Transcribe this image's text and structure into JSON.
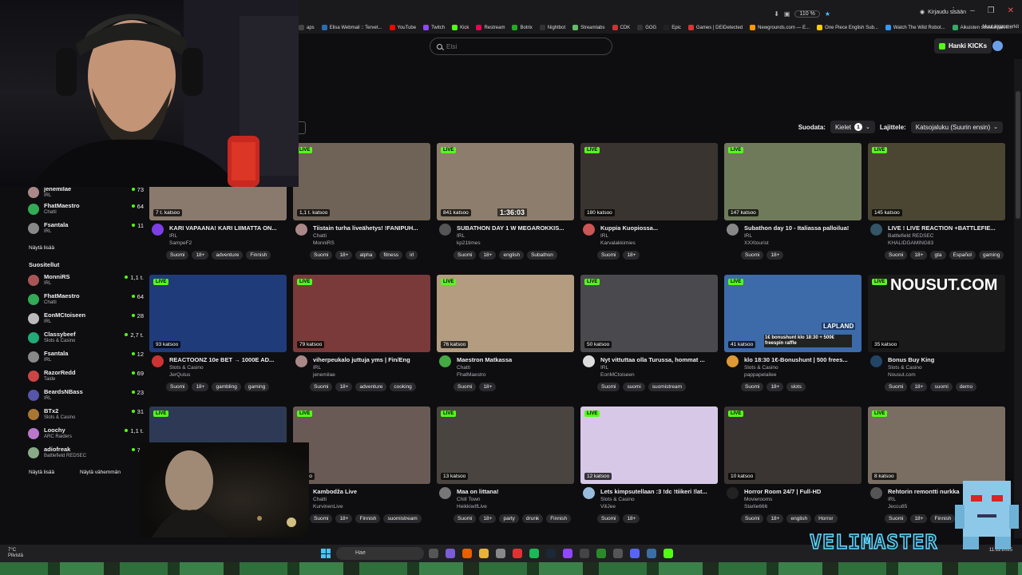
{
  "browser": {
    "zoom": "110 %",
    "signin": "Kirjaudu sisään",
    "bookmarks": [
      "aps",
      "Elisa Webmail :: Tervet...",
      "YouTube",
      "Twitch",
      "Kick",
      "Restream",
      "Botrix",
      "Nightbot",
      "Streamlabs",
      "CDK",
      "GOG",
      "Epic",
      "Games | DEIDetected",
      "Newgrounds.com — E...",
      "One Piece English Sub...",
      "Watch The Wild Robot...",
      "Aikuisten sosiaalipalve..."
    ],
    "bookmarks_more": "Muut kirjanmerkit"
  },
  "header": {
    "search_placeholder": "Etsi",
    "get_kicks": "Hanki KICKs"
  },
  "filters": {
    "sort_by_label": "Suodata:",
    "languages_label": "Kielet",
    "languages_count": "1",
    "sort_label": "Lajittele:",
    "sort_value": "Katsojaluku (Suurin ensin)"
  },
  "sidebar": {
    "followed_partial": {
      "name": "jenemilae",
      "category": "IRL",
      "count": "73"
    },
    "followed": [
      {
        "name": "FhatMaestro",
        "category": "Chatti",
        "count": "64"
      },
      {
        "name": "Fsantala",
        "category": "IRL",
        "count": "11"
      }
    ],
    "show_more": "Näytä lisää",
    "recommended_title": "Suositellut",
    "recommended": [
      {
        "name": "MonniRS",
        "category": "IRL",
        "count": "1,1 t."
      },
      {
        "name": "FhatMaestro",
        "category": "Chatti",
        "count": "64"
      },
      {
        "name": "EonMCtoiseen",
        "category": "IRL",
        "count": "28"
      },
      {
        "name": "Classybeef",
        "category": "Slots & Casino",
        "count": "2,7 t."
      },
      {
        "name": "Fsantala",
        "category": "IRL",
        "count": "12"
      },
      {
        "name": "RazorRedd",
        "category": "Taide",
        "count": "69"
      },
      {
        "name": "BeardsNBass",
        "category": "IRL",
        "count": "23"
      },
      {
        "name": "BTx2",
        "category": "Slots & Casino",
        "count": "31"
      },
      {
        "name": "Loochy",
        "category": "ARC Raiders",
        "count": "1,1 t."
      },
      {
        "name": "adiofreak",
        "category": "Battlefield REDSEC",
        "count": "76"
      }
    ],
    "show_more2": "Näytä lisää",
    "show_less": "Näytä vähemmän"
  },
  "streams": [
    {
      "live": "LIVE",
      "viewers": "7 t. katsoo",
      "title": "KARI VAPAANA! KARI LIIMATTA ON...",
      "category": "IRL",
      "user": "SampeF2",
      "tags": [
        "Suomi",
        "18+",
        "adventure",
        "Finnish"
      ],
      "thumb_color": "#8a7a6e",
      "avatar_color": "#7b3fe4"
    },
    {
      "live": "LIVE",
      "viewers": "1,1 t. katsoo",
      "title": "Tiistain turha liveähetys! !FANIPUH...",
      "category": "Chatti",
      "user": "MonniRS",
      "tags": [
        "Suomi",
        "18+",
        "alpha",
        "fitness",
        "irl"
      ],
      "thumb_color": "#6f6256",
      "avatar_color": "#a88"
    },
    {
      "live": "LIVE",
      "viewers": "841 katsoo",
      "title": "SUBATHON DAY 1 W MEGAROKKIS...",
      "category": "IRL",
      "user": "kp21times",
      "tags": [
        "Suomi",
        "18+",
        "english",
        "Subathon"
      ],
      "thumb_color": "#8c7d6c",
      "avatar_color": "#555"
    },
    {
      "live": "LIVE",
      "viewers": "180 katsoo",
      "title": "Kuppia Kuopiossa...",
      "category": "IRL",
      "user": "Karvalakkimies",
      "tags": [
        "Suomi",
        "18+"
      ],
      "thumb_color": "#3a3430",
      "avatar_color": "#c55"
    },
    {
      "live": "LIVE",
      "viewers": "147 katsoo",
      "title": "Subathon day 10 - Italiassa palloilua!",
      "category": "IRL",
      "user": "XXXtourist",
      "tags": [
        "Suomi",
        "18+"
      ],
      "thumb_color": "#6f7a5a",
      "avatar_color": "#888"
    },
    {
      "live": "LIVE",
      "viewers": "145 katsoo",
      "title": "LIVE ! LIVE REACTION +BATTLEFIE...",
      "category": "Battlefield REDSEC",
      "user": "KHALIDGAMING83",
      "tags": [
        "Suomi",
        "18+",
        "gta",
        "Español",
        "gaming"
      ],
      "thumb_color": "#4a4632",
      "avatar_color": "#356"
    },
    {
      "live": "LIVE",
      "viewers": "93 katsoo",
      "title": "REACTOONZ 10e BET → 1000E AD...",
      "category": "Slots & Casino",
      "user": "JerQutus",
      "tags": [
        "Suomi",
        "18+",
        "gambling",
        "gaming"
      ],
      "thumb_color": "#1f3b7a",
      "avatar_color": "#c33"
    },
    {
      "live": "LIVE",
      "viewers": "79 katsoo",
      "title": "viherpeukalo juttuja yms | Fin/Eng",
      "category": "IRL",
      "user": "jenemilae",
      "tags": [
        "Suomi",
        "18+",
        "adventure",
        "cooking"
      ],
      "thumb_color": "#7a3a3a",
      "avatar_color": "#a88"
    },
    {
      "live": "LIVE",
      "viewers": "76 katsoo",
      "title": "Maestron Matkassa",
      "category": "Chatti",
      "user": "FhatMaestro",
      "tags": [
        "Suomi",
        "18+"
      ],
      "thumb_color": "#b39c80",
      "avatar_color": "#4a4"
    },
    {
      "live": "LIVE",
      "viewers": "50 katsoo",
      "title": "Nyt vittuttaa olla Turussa, hommat ...",
      "category": "IRL",
      "user": "EonMCtoiseen",
      "tags": [
        "Suomi",
        "suomi",
        "suomistream"
      ],
      "thumb_color": "#4a4a4e",
      "avatar_color": "#ddd"
    },
    {
      "live": "LIVE",
      "viewers": "41 katsoo",
      "title": "klo 18:30 1€-Bonushunt | 500 frees...",
      "category": "Slots & Casino",
      "user": "pappapelailee",
      "tags": [
        "Suomi",
        "18+",
        "slots"
      ],
      "thumb_color": "#3d6aa8",
      "avatar_color": "#d93"
    },
    {
      "live": "LIVE",
      "viewers": "35 katsoo",
      "title": "Bonus Buy King",
      "category": "Slots & Casino",
      "user": "Nousut.com",
      "tags": [
        "Suomi",
        "18+",
        "suomi",
        "demo"
      ],
      "thumb_color": "#1a1a1a",
      "avatar_color": "#246"
    },
    {
      "live": "LIVE",
      "viewers": "",
      "title": "",
      "category": "",
      "user": "",
      "tags": [],
      "thumb_color": "#2e3a55",
      "avatar_color": "#333"
    },
    {
      "live": "LIVE",
      "viewers": "atsoo",
      "title": "Kambodža Live",
      "category": "Chatti",
      "user": "KurvinenLive",
      "tags": [
        "Suomi",
        "18+",
        "Finnish",
        "suomistream"
      ],
      "thumb_color": "#6a5a55",
      "avatar_color": "#333"
    },
    {
      "live": "LIVE",
      "viewers": "13 katsoo",
      "title": "Maa on littana!",
      "category": "Chill Town",
      "user": "HeikkiwtfLive",
      "tags": [
        "Suomi",
        "18+",
        "party",
        "drunk",
        "Finnish"
      ],
      "thumb_color": "#4a4440",
      "avatar_color": "#777"
    },
    {
      "live": "LIVE",
      "viewers": "12 katsoo",
      "title": "Lets kimpsutellaan :3 !dc !tiikeri !lat...",
      "category": "Slots & Casino",
      "user": "ViliJee",
      "tags": [
        "Suomi",
        "18+"
      ],
      "thumb_color": "#d8c8e8",
      "avatar_color": "#9bd"
    },
    {
      "live": "LIVE",
      "viewers": "10 katsoo",
      "title": "Horror Room 24/7 | Full-HD",
      "category": "Movierooms",
      "user": "Starlie666",
      "tags": [
        "Suomi",
        "18+",
        "english",
        "Horror"
      ],
      "thumb_color": "#3a3532",
      "avatar_color": "#222"
    },
    {
      "live": "LIVE",
      "viewers": "8 katsoo",
      "title": "Rehtorin remontti nurkka",
      "category": "IRL",
      "user": "Jeccu85",
      "tags": [
        "Suomi",
        "18+",
        "Finnish"
      ],
      "thumb_color": "#7a6e62",
      "avatar_color": "#555"
    }
  ],
  "thumb_texts": {
    "nousut": "NOUSUT.COM",
    "lapland": "LAPLAND",
    "bonushunt": "1€ bonushunt klo 18:30 + 500€ freespin raffle",
    "timer": "1:36:03"
  },
  "taskbar": {
    "weather_temp": "7°C",
    "weather_desc": "Pilvistä",
    "search": "Hae",
    "date": "11.11.2025"
  },
  "brand": "VELIMASTER"
}
